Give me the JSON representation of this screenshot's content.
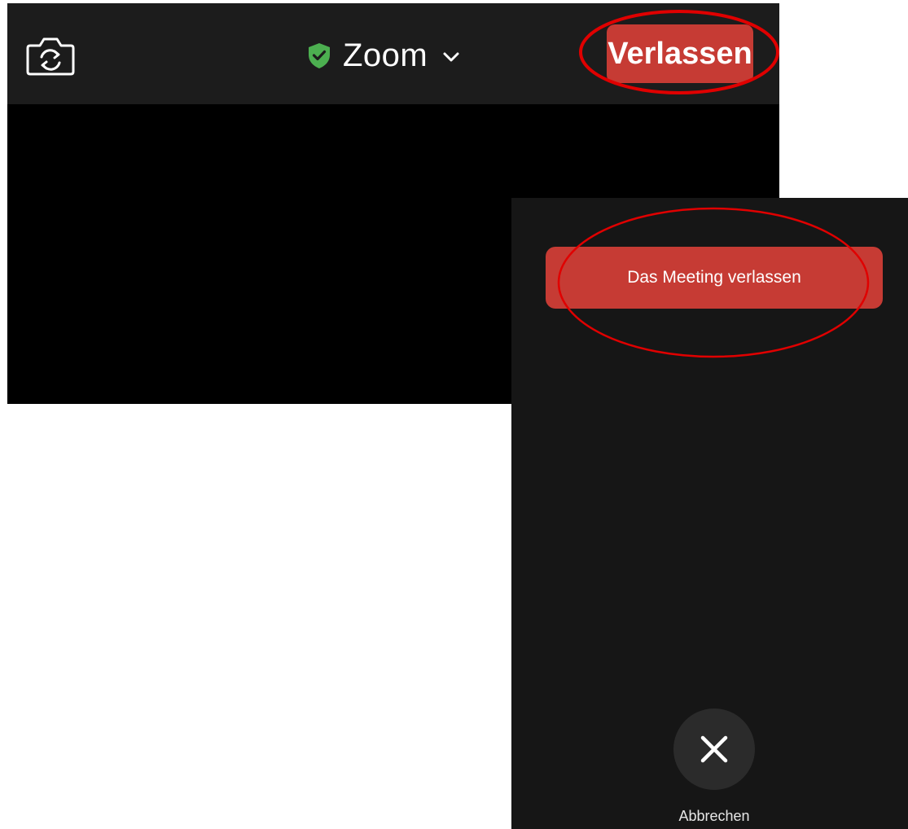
{
  "meeting": {
    "title": "Zoom",
    "leave_label": "Verlassen",
    "icons": {
      "camera_switch": "camera-switch-icon",
      "shield": "shield-check-icon",
      "chevron": "chevron-down-icon"
    },
    "colors": {
      "top_bar": "#1c1c1c",
      "shield_green": "#4caf50",
      "leave_red": "#c63b34"
    }
  },
  "leave_dialog": {
    "leave_meeting_label": "Das Meeting verlassen",
    "cancel_label": "Abbrechen",
    "icons": {
      "cancel": "close-icon"
    },
    "colors": {
      "background": "#161616",
      "button_red": "#c63b34"
    }
  },
  "annotations": {
    "color": "#e00000"
  }
}
